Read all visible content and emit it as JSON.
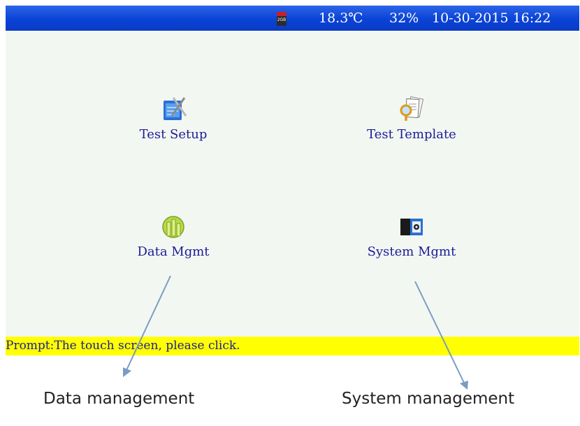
{
  "status_bar": {
    "sdcard_label": "2GB",
    "temperature": "18.3℃",
    "humidity": "32%",
    "datetime": "10-30-2015 16:22"
  },
  "menu": {
    "items": [
      {
        "label": "Test Setup",
        "icon": "test-setup-icon"
      },
      {
        "label": "Test Template",
        "icon": "test-template-icon"
      },
      {
        "label": "Data Mgmt",
        "icon": "data-mgmt-icon"
      },
      {
        "label": "System Mgmt",
        "icon": "system-mgmt-icon"
      }
    ]
  },
  "prompt": {
    "text": "Prompt:The touch screen, please click."
  },
  "annotations": {
    "data_management": "Data management",
    "system_management": "System management"
  },
  "colors": {
    "status_bar": "#0a43d6",
    "screen_bg": "#f3f7f2",
    "prompt_bg": "#ffff00",
    "label_text": "#1c1c96",
    "arrow": "#7a9cc4"
  }
}
